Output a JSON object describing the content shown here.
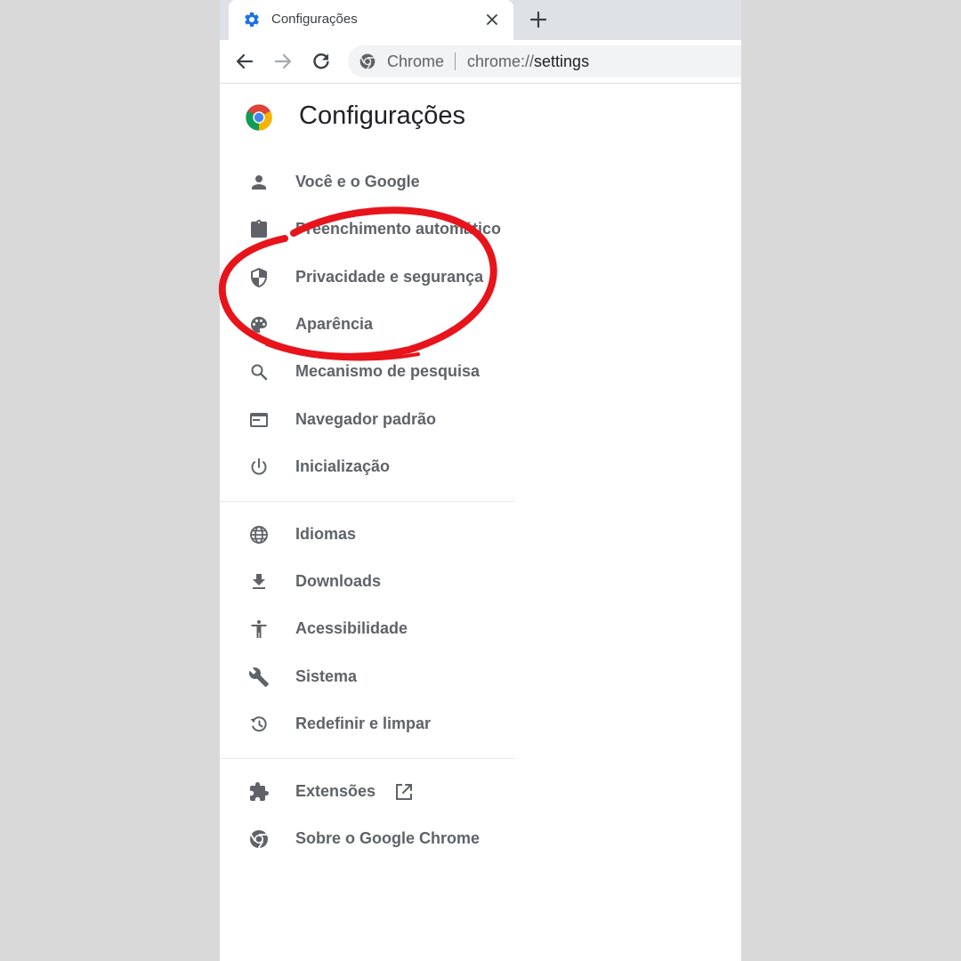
{
  "tab": {
    "title": "Configurações"
  },
  "omnibox": {
    "chip": "Chrome",
    "url_prefix": "chrome://",
    "url_path": "settings"
  },
  "page": {
    "title": "Configurações"
  },
  "nav": {
    "items": [
      {
        "label": "Você e o Google",
        "icon": "person-icon"
      },
      {
        "label": "Preenchimento automático",
        "icon": "clipboard-icon"
      },
      {
        "label": "Privacidade e segurança",
        "icon": "shield-icon"
      },
      {
        "label": "Aparência",
        "icon": "palette-icon"
      },
      {
        "label": "Mecanismo de pesquisa",
        "icon": "search-icon"
      },
      {
        "label": "Navegador padrão",
        "icon": "browser-window-icon"
      },
      {
        "label": "Inicialização",
        "icon": "power-icon"
      },
      {
        "label": "Idiomas",
        "icon": "globe-icon"
      },
      {
        "label": "Downloads",
        "icon": "download-icon"
      },
      {
        "label": "Acessibilidade",
        "icon": "accessibility-icon"
      },
      {
        "label": "Sistema",
        "icon": "wrench-icon"
      },
      {
        "label": "Redefinir e limpar",
        "icon": "restore-icon"
      },
      {
        "label": "Extensões",
        "icon": "puzzle-icon"
      },
      {
        "label": "Sobre o Google Chrome",
        "icon": "chrome-icon"
      }
    ]
  },
  "colors": {
    "annotation": "#e8141b",
    "icon": "#5f6368",
    "tab_icon": "#1a73e8",
    "tabstrip": "#dee1e6",
    "backdrop": "#d9d9d9"
  }
}
